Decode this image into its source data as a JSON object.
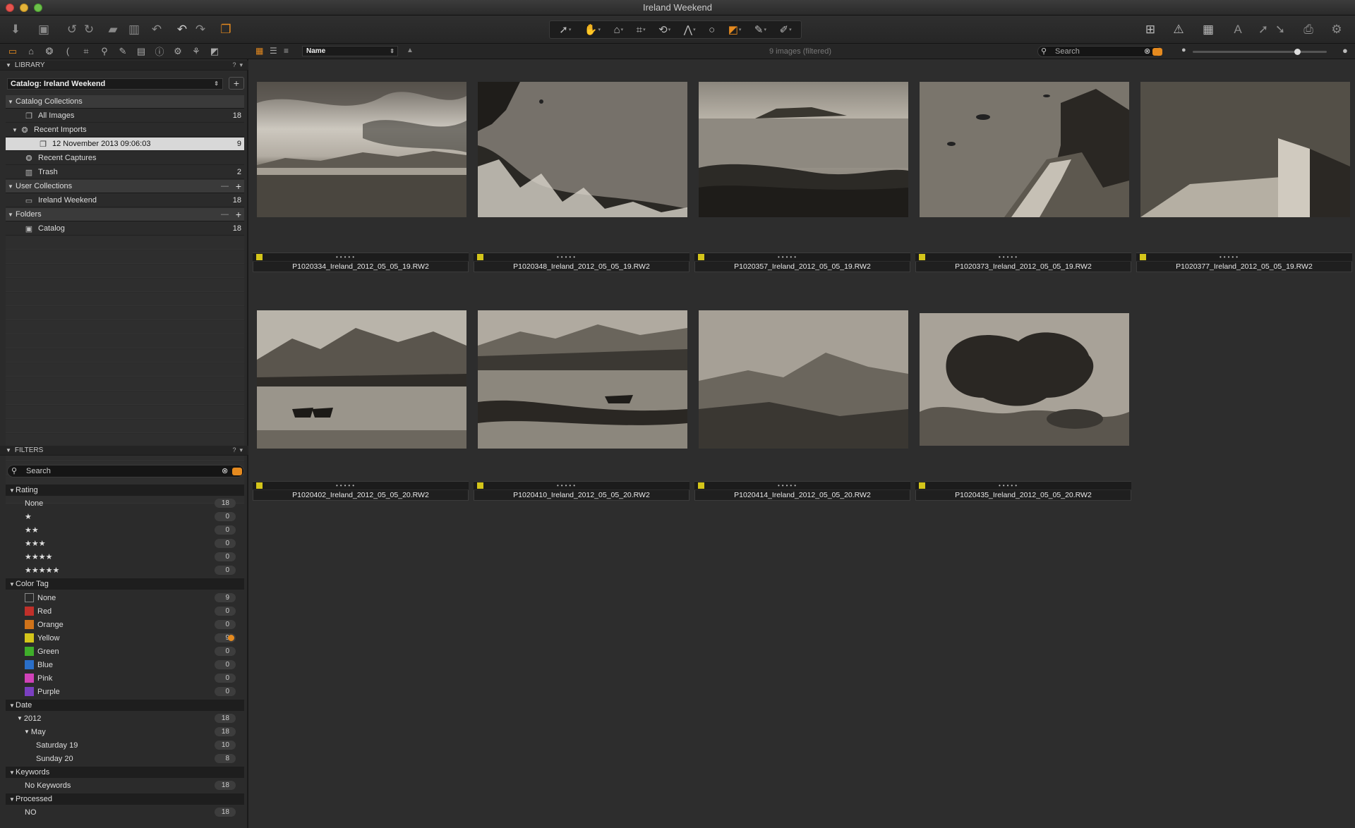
{
  "window": {
    "title": "Ireland Weekend"
  },
  "library": {
    "header": "LIBRARY",
    "catalog_select": "Catalog: Ireland Weekend",
    "catalog_collections_label": "Catalog Collections",
    "all_images": {
      "label": "All Images",
      "count": "18"
    },
    "recent_imports": {
      "label": "Recent Imports"
    },
    "import_item": {
      "label": "12 November 2013 09:06:03",
      "count": "9"
    },
    "recent_captures": {
      "label": "Recent Captures"
    },
    "trash": {
      "label": "Trash",
      "count": "2"
    },
    "user_collections_label": "User Collections",
    "ireland_weekend": {
      "label": "Ireland Weekend",
      "count": "18"
    },
    "folders_label": "Folders",
    "catalog_folder": {
      "label": "Catalog",
      "count": "18"
    }
  },
  "filters": {
    "header": "FILTERS",
    "search_placeholder": "Search",
    "rating": {
      "label": "Rating",
      "items": [
        {
          "label": "None",
          "count": "18"
        },
        {
          "label": "★",
          "count": "0"
        },
        {
          "label": "★★",
          "count": "0"
        },
        {
          "label": "★★★",
          "count": "0"
        },
        {
          "label": "★★★★",
          "count": "0"
        },
        {
          "label": "★★★★★",
          "count": "0"
        }
      ]
    },
    "color_tag": {
      "label": "Color Tag",
      "items": [
        {
          "label": "None",
          "count": "9",
          "color": "#2a2a2a"
        },
        {
          "label": "Red",
          "count": "0",
          "color": "#c0302a"
        },
        {
          "label": "Orange",
          "count": "0",
          "color": "#d0731a"
        },
        {
          "label": "Yellow",
          "count": "9",
          "color": "#d4c51a"
        },
        {
          "label": "Green",
          "count": "0",
          "color": "#3fae2a"
        },
        {
          "label": "Blue",
          "count": "0",
          "color": "#2a6fc9"
        },
        {
          "label": "Pink",
          "count": "0",
          "color": "#d042b8"
        },
        {
          "label": "Purple",
          "count": "0",
          "color": "#7a3fc0"
        }
      ]
    },
    "date": {
      "label": "Date",
      "year": {
        "label": "2012",
        "count": "18"
      },
      "month": {
        "label": "May",
        "count": "18"
      },
      "days": [
        {
          "label": "Saturday 19",
          "count": "10"
        },
        {
          "label": "Sunday 20",
          "count": "8"
        }
      ]
    },
    "keywords": {
      "label": "Keywords",
      "items": [
        {
          "label": "No Keywords",
          "count": "18"
        }
      ]
    },
    "processed": {
      "label": "Processed",
      "items": [
        {
          "label": "NO",
          "count": "18"
        }
      ]
    }
  },
  "browser": {
    "sort_label": "Name",
    "status": "9 images (filtered)",
    "search_placeholder": "Search",
    "images": [
      {
        "name": "P1020334_Ireland_2012_05_05_19.RW2",
        "scene": "beach"
      },
      {
        "name": "P1020348_Ireland_2012_05_05_19.RW2",
        "scene": "sea-grass"
      },
      {
        "name": "P1020357_Ireland_2012_05_05_19.RW2",
        "scene": "bay-island"
      },
      {
        "name": "P1020373_Ireland_2012_05_05_19.RW2",
        "scene": "cliff-path"
      },
      {
        "name": "P1020377_Ireland_2012_05_05_19.RW2",
        "scene": "pier"
      },
      {
        "name": "P1020402_Ireland_2012_05_05_20.RW2",
        "scene": "lake-boats"
      },
      {
        "name": "P1020410_Ireland_2012_05_05_20.RW2",
        "scene": "lake-boat"
      },
      {
        "name": "P1020414_Ireland_2012_05_05_20.RW2",
        "scene": "hills"
      },
      {
        "name": "P1020435_Ireland_2012_05_05_20.RW2",
        "scene": "clouds"
      }
    ]
  },
  "colors": {
    "accent": "#e58a1f",
    "tag_yellow": "#d4c51a"
  }
}
